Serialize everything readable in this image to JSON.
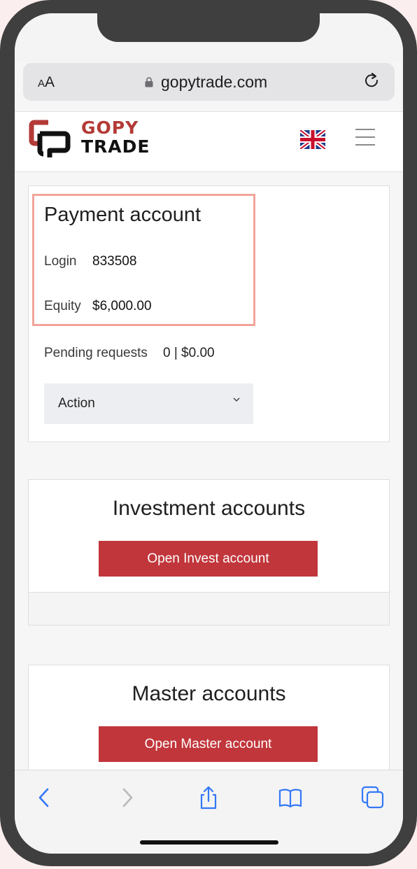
{
  "browser": {
    "text_size_label_small": "A",
    "text_size_label_large": "A",
    "url": "gopytrade.com"
  },
  "header": {
    "logo_top": "GOPY",
    "logo_bottom": "TRADE",
    "colors": {
      "brand_red": "#b33a36",
      "brand_dark": "#111111"
    }
  },
  "payment": {
    "title": "Payment account",
    "login_label": "Login",
    "login_value": "833508",
    "equity_label": "Equity",
    "equity_value": "$6,000.00",
    "pending_label": "Pending requests",
    "pending_value": "0 | $0.00",
    "action_label": "Action"
  },
  "investment": {
    "title": "Investment accounts",
    "button_label": "Open Invest account"
  },
  "master": {
    "title": "Master accounts",
    "button_label": "Open Master account"
  },
  "toolbar": {
    "icons": [
      "back-icon",
      "forward-icon",
      "share-icon",
      "bookmarks-icon",
      "tabs-icon"
    ],
    "accent": "#3478f6"
  }
}
